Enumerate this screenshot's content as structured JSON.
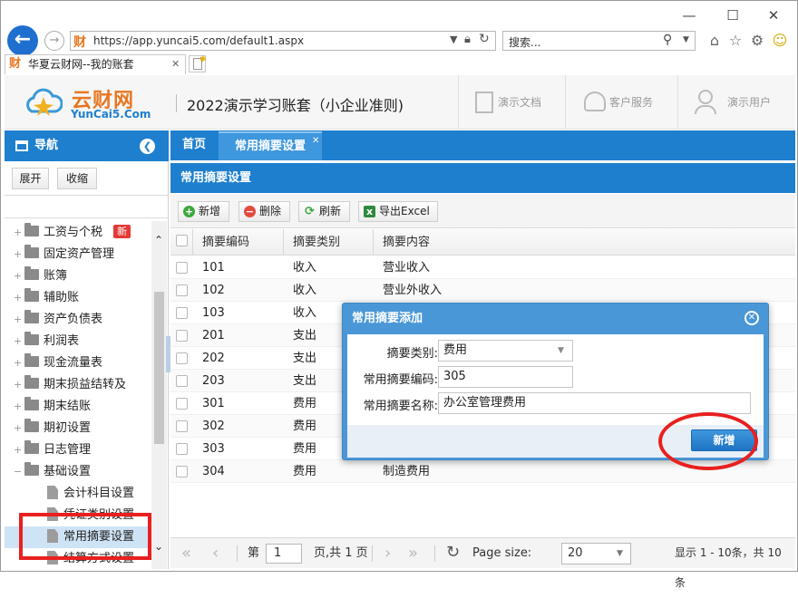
{
  "browser": {
    "url": "https://app.yuncai5.com/default1.aspx",
    "search_placeholder": "搜索...",
    "tab_title": "华夏云财网--我的账套",
    "addr_logo": "财",
    "tab_logo": "财"
  },
  "header": {
    "logo_cn": "云财网",
    "logo_en": "YunCai5.Com",
    "account_title": "2022演示学习账套（小企业准则)",
    "buttons": [
      "演示文档",
      "客户服务",
      "演示用户"
    ]
  },
  "sidebar": {
    "title": "导航",
    "expand_label": "展开",
    "collapse_label": "收缩",
    "new_badge": "新",
    "items": [
      {
        "label": "工资与个税",
        "level": 0,
        "kind": "folder",
        "badge": true
      },
      {
        "label": "固定资产管理",
        "level": 0,
        "kind": "folder"
      },
      {
        "label": "账簿",
        "level": 0,
        "kind": "folder"
      },
      {
        "label": "辅助账",
        "level": 0,
        "kind": "folder"
      },
      {
        "label": "资产负债表",
        "level": 0,
        "kind": "folder"
      },
      {
        "label": "利润表",
        "level": 0,
        "kind": "folder"
      },
      {
        "label": "现金流量表",
        "level": 0,
        "kind": "folder"
      },
      {
        "label": "期末损益结转及",
        "level": 0,
        "kind": "folder"
      },
      {
        "label": "期末结账",
        "level": 0,
        "kind": "folder"
      },
      {
        "label": "期初设置",
        "level": 0,
        "kind": "folder"
      },
      {
        "label": "日志管理",
        "level": 0,
        "kind": "folder"
      },
      {
        "label": "基础设置",
        "level": 0,
        "kind": "folder-open"
      },
      {
        "label": "会计科目设置",
        "level": 1,
        "kind": "doc"
      },
      {
        "label": "凭证类别设置",
        "level": 1,
        "kind": "doc"
      },
      {
        "label": "常用摘要设置",
        "level": 1,
        "kind": "doc",
        "selected": true
      },
      {
        "label": "结算方式设置",
        "level": 1,
        "kind": "doc"
      }
    ]
  },
  "main": {
    "tabs": [
      {
        "label": "首页",
        "active": false
      },
      {
        "label": "常用摘要设置",
        "active": true
      }
    ],
    "panel_title": "常用摘要设置",
    "toolbar": {
      "add": "新增",
      "delete": "删除",
      "refresh": "刷新",
      "export": "导出Excel"
    },
    "columns": [
      "摘要编码",
      "摘要类别",
      "摘要内容"
    ],
    "rows": [
      [
        "101",
        "收入",
        "营业收入"
      ],
      [
        "102",
        "收入",
        "营业外收入"
      ],
      [
        "103",
        "收入",
        ""
      ],
      [
        "201",
        "支出",
        ""
      ],
      [
        "202",
        "支出",
        ""
      ],
      [
        "203",
        "支出",
        ""
      ],
      [
        "301",
        "费用",
        ""
      ],
      [
        "302",
        "费用",
        ""
      ],
      [
        "303",
        "费用",
        ""
      ],
      [
        "304",
        "费用",
        "制造费用"
      ]
    ],
    "pager": {
      "page_prefix": "第",
      "page": "1",
      "page_suffix": "页,共 1 页",
      "page_size_label": "Page size:",
      "page_size": "20",
      "summary": "显示 1 - 10条，共 10 条"
    }
  },
  "dialog": {
    "title": "常用摘要添加",
    "category_label": "摘要类别:",
    "category_value": "费用",
    "code_label": "常用摘要编码:",
    "code_value": "305",
    "name_label": "常用摘要名称:",
    "name_value": "办公室管理费用",
    "submit_label": "新增"
  },
  "colors": {
    "accent": "#1e7fce",
    "annotation": "#e8201f",
    "badge": "#e53935"
  }
}
